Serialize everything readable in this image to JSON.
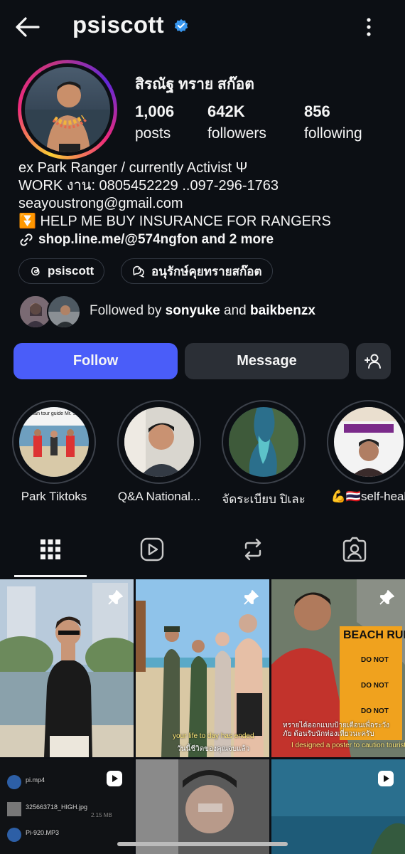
{
  "header": {
    "username": "psiscott",
    "icons": [
      "back-arrow-icon",
      "verified-badge-icon",
      "more-vertical-icon"
    ]
  },
  "profile": {
    "display_name": "สิรณัฐ ทราย สก๊อต",
    "stats": [
      {
        "value": "1,006",
        "label": "posts"
      },
      {
        "value": "642K",
        "label": "followers"
      },
      {
        "value": "856",
        "label": "following"
      }
    ],
    "bio": [
      "ex Park Ranger / currently Activist  Ψ",
      "WORK งาน: 0805452229 ..097-296-1763",
      "seayoustrong@gmail.com",
      "⏬ HELP ME BUY INSURANCE FOR RANGERS"
    ],
    "link": "shop.line.me/@574ngfon and 2 more",
    "threads_handle": "psiscott",
    "community_label": "อนุรักษ์คุยทรายสก๊อต"
  },
  "followed_by": {
    "prefix": "Followed by ",
    "user1": "sonyuke",
    "joiner": " and ",
    "user2": "baikbenzx"
  },
  "actions": {
    "follow_label": "Follow",
    "message_label": "Message",
    "add_icon": "add-person-icon"
  },
  "highlights": [
    {
      "label": "Park Tiktoks",
      "thumb_text": "russian tour guide Mr. Scott"
    },
    {
      "label": "Q&A National..."
    },
    {
      "label": "จัดระเบียบ ปิเละ"
    },
    {
      "label": "💪🇹🇭self-heal"
    }
  ],
  "tabs": [
    "grid-icon",
    "reels-icon",
    "reposts-icon",
    "tagged-icon"
  ],
  "grid_posts": [
    {
      "pinned": true
    },
    {
      "pinned": true,
      "caption_top": "your life to day has ended",
      "caption_bottom": "วันนี้ชีวิตของคุณจบแล้ว"
    },
    {
      "pinned": true,
      "sign_title": "BEACH RULES",
      "sign_lines": [
        "DO NOT",
        "DO NOT",
        "DO NOT"
      ],
      "caption_th": "ทรายได้ออกแบบป้ายเตือนเพื่อระวังภัย ต้อนรับนักท่องเที่ยวนะครับ",
      "caption_en": "I designed a poster to caution tourists"
    },
    {
      "type": "reel",
      "files": [
        "pi.mp4",
        "325663718_HIGH.jpg",
        "Pi-920.MP3"
      ],
      "size": "2.15 MB"
    },
    {
      "type": "photo"
    },
    {
      "type": "reel"
    }
  ],
  "colors": {
    "background": "#0c0f14",
    "follow_button": "#4a5df9",
    "secondary_button": "#2b2f36",
    "verified": "#3897f0"
  }
}
